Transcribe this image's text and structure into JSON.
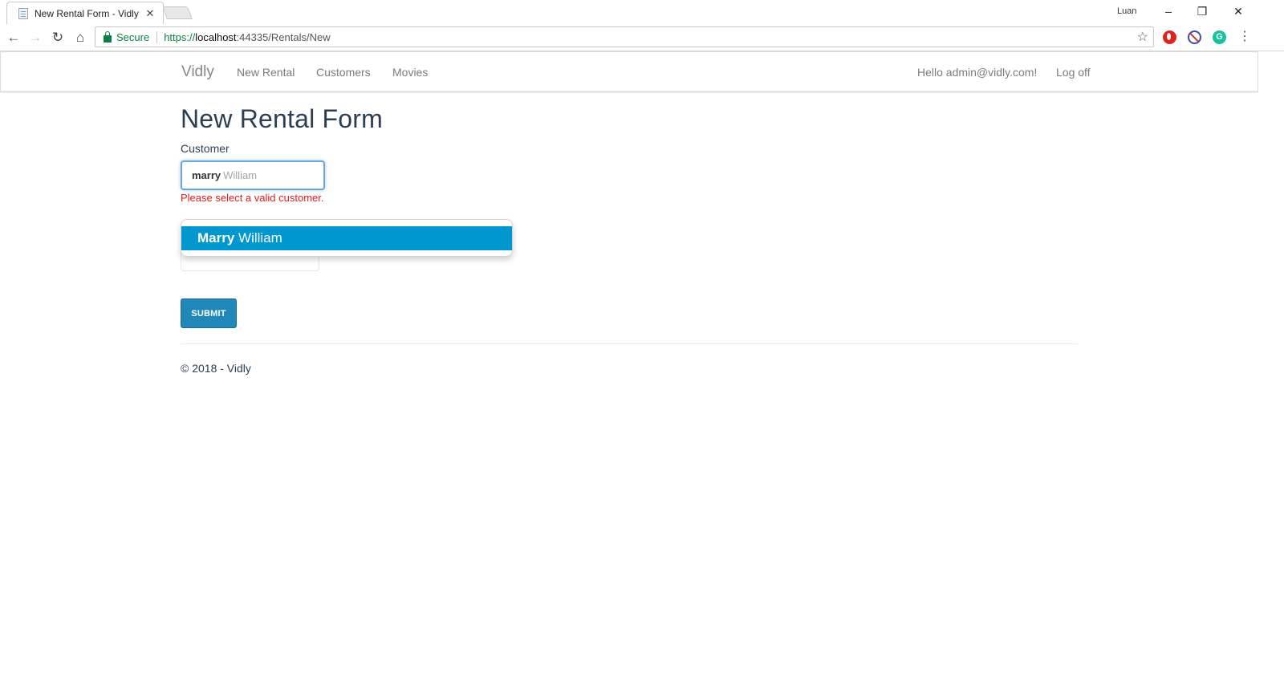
{
  "browser": {
    "tab_title": "New Rental Form - Vidly",
    "tab_close": "✕",
    "profile": "Luan",
    "secure_label": "Secure",
    "url_scheme": "https://",
    "url_host": "localhost",
    "url_path": ":44335/Rentals/New",
    "ext_grammarly": "G"
  },
  "navbar": {
    "brand": "Vidly",
    "links": [
      "New Rental",
      "Customers",
      "Movies"
    ],
    "greeting": "Hello admin@vidly.com!",
    "logoff": "Log off"
  },
  "form": {
    "title": "New Rental Form",
    "customer_label": "Customer",
    "customer_typed": "marry",
    "customer_hint": "William",
    "error": "Please select a valid customer.",
    "suggestion_match": "Marry",
    "suggestion_rest": "William",
    "submit_label": "SUBMIT"
  },
  "footer": {
    "text": "© 2018 - Vidly"
  },
  "colors": {
    "accent": "#0097cf",
    "button": "#1f88b8",
    "error": "#e21b1b",
    "secure": "#0b8043"
  }
}
